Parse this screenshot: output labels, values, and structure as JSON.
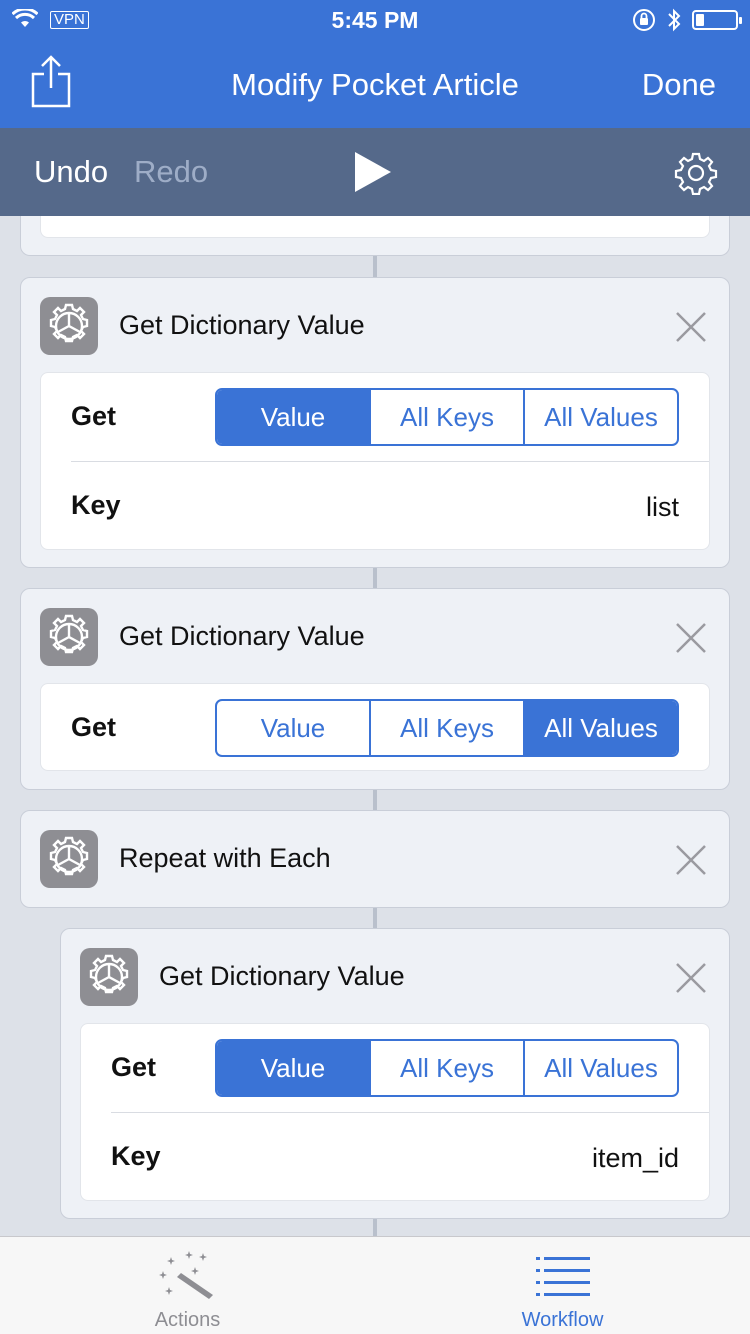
{
  "status": {
    "vpn": "VPN",
    "time": "5:45 PM",
    "battery_level": 0.2
  },
  "nav": {
    "title": "Modify Pocket Article",
    "done": "Done"
  },
  "toolbar": {
    "undo": "Undo",
    "redo": "Redo"
  },
  "colors": {
    "accent": "#3a73d6",
    "toolbar": "#55698a",
    "canvas": "#dde1e8"
  },
  "actions": [
    {
      "name": "Get Dictionary Value",
      "get_label": "Get",
      "options": [
        "Value",
        "All Keys",
        "All Values"
      ],
      "selected": "Value",
      "key_label": "Key",
      "key_value": "list"
    },
    {
      "name": "Get Dictionary Value",
      "get_label": "Get",
      "options": [
        "Value",
        "All Keys",
        "All Values"
      ],
      "selected": "All Values"
    },
    {
      "name": "Repeat with Each"
    },
    {
      "name": "Get Dictionary Value",
      "get_label": "Get",
      "options": [
        "Value",
        "All Keys",
        "All Values"
      ],
      "selected": "Value",
      "key_label": "Key",
      "key_value": "item_id"
    }
  ],
  "tabs": [
    {
      "label": "Actions",
      "icon": "magic-wand-icon",
      "active": false
    },
    {
      "label": "Workflow",
      "icon": "list-icon",
      "active": true
    }
  ]
}
